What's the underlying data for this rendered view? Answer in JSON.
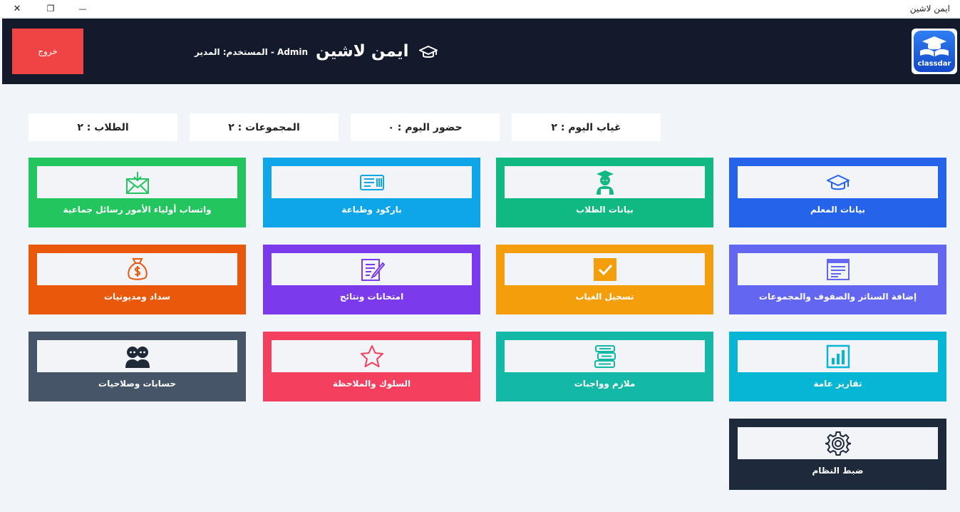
{
  "window": {
    "title": "ايمن لاشين",
    "close_glyph": "✕",
    "restore_glyph": "❐",
    "minimize_glyph": "—"
  },
  "header": {
    "logout_label": "خروج",
    "user_label": "المستخدم: المدير - Admin",
    "brand_name": "ايمن لاشين",
    "logo_text": "classdar"
  },
  "stats": [
    {
      "label": "الطلاب : ٢"
    },
    {
      "label": "المجموعات : ٢"
    },
    {
      "label": "حضور اليوم : ٠"
    },
    {
      "label": "غياب اليوم : ٢"
    }
  ],
  "tiles": [
    {
      "label": "واتساب أولياء الأمور رسائل جماعية",
      "icon": "envelope-icon",
      "color": "#22c55e",
      "icon_color": "#22c55e"
    },
    {
      "label": "باركود وطباعة",
      "icon": "barcode-card-icon",
      "color": "#0ea5e9",
      "icon_color": "#0ea5e9"
    },
    {
      "label": "بيانات الطلاب",
      "icon": "student-icon",
      "color": "#10b981",
      "icon_color": "#10b981"
    },
    {
      "label": "بيانات المعلم",
      "icon": "graduation-cap-icon",
      "color": "#2563eb",
      "icon_color": "#2563eb"
    },
    {
      "label": "سداد ومديونيات",
      "icon": "money-bag-icon",
      "color": "#ea580c",
      "icon_color": "#ea580c"
    },
    {
      "label": "امتحانات ونتائج",
      "icon": "exam-edit-icon",
      "color": "#7c3aed",
      "icon_color": "#7c3aed"
    },
    {
      "label": "تسجيل الغياب",
      "icon": "checkbox-icon",
      "color": "#f59e0b",
      "icon_color": "#f59e0b"
    },
    {
      "label": "إضافة السناتر والصفوف والمجموعات",
      "icon": "document-list-icon",
      "color": "#6366f1",
      "icon_color": "#6366f1"
    },
    {
      "label": "حسابات وصلاحيات",
      "icon": "users-icon",
      "color": "#475569",
      "icon_color": "#1f2937"
    },
    {
      "label": "السلوك والملاحظة",
      "icon": "star-icon",
      "color": "#f43f5e",
      "icon_color": "#f43f5e"
    },
    {
      "label": "ملازم وواجبات",
      "icon": "books-icon",
      "color": "#14b8a6",
      "icon_color": "#14b8a6"
    },
    {
      "label": "تقارير عامة",
      "icon": "bar-chart-icon",
      "color": "#06b6d4",
      "icon_color": "#06b6d4"
    },
    {
      "label": "ضبط النظام",
      "icon": "gear-icon",
      "color": "#1e293b",
      "icon_color": "#1e293b"
    }
  ]
}
